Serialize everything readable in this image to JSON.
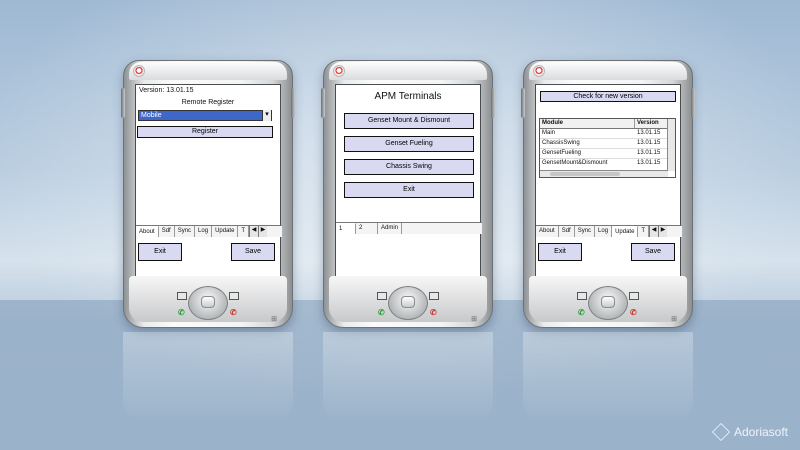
{
  "branding": {
    "logo_text": "Adoriasoft"
  },
  "devices": [
    {
      "id": "register",
      "screen": {
        "version_label": "Version: 13.01.15",
        "title": "Remote Register",
        "dropdown_value": "Mobile",
        "register_label": "Register",
        "tabs": [
          "About",
          "Sdf",
          "Sync",
          "Log",
          "Update",
          "T"
        ],
        "active_tab": "About",
        "exit_label": "Exit",
        "save_label": "Save"
      }
    },
    {
      "id": "menu",
      "screen": {
        "title": "APM Terminals",
        "menu": [
          "Genset Mount & Dismount",
          "Genset Fueling",
          "Chassis Swing",
          "Exit"
        ],
        "tabs": [
          "1",
          "2",
          "Admin"
        ],
        "active_tab": "1"
      }
    },
    {
      "id": "update",
      "screen": {
        "check_label": "Check for new version",
        "table_headers": [
          "Module",
          "Version"
        ],
        "table_rows": [
          [
            "Main",
            "13.01.15"
          ],
          [
            "ChassisSwing",
            "13.01.15"
          ],
          [
            "GensetFueling",
            "13.01.15"
          ],
          [
            "GensetMount&Dismount",
            "13.01.15"
          ]
        ],
        "tabs": [
          "About",
          "Sdf",
          "Sync",
          "Log",
          "Update",
          "T"
        ],
        "active_tab": "Update",
        "exit_label": "Exit",
        "save_label": "Save"
      }
    }
  ],
  "icons": {
    "power": "power-icon",
    "windows": "windows-logo-icon",
    "call": "call-icon",
    "end_call": "end-call-icon",
    "scroll_left": "◀",
    "scroll_right": "▶",
    "dropdown": "▾"
  }
}
